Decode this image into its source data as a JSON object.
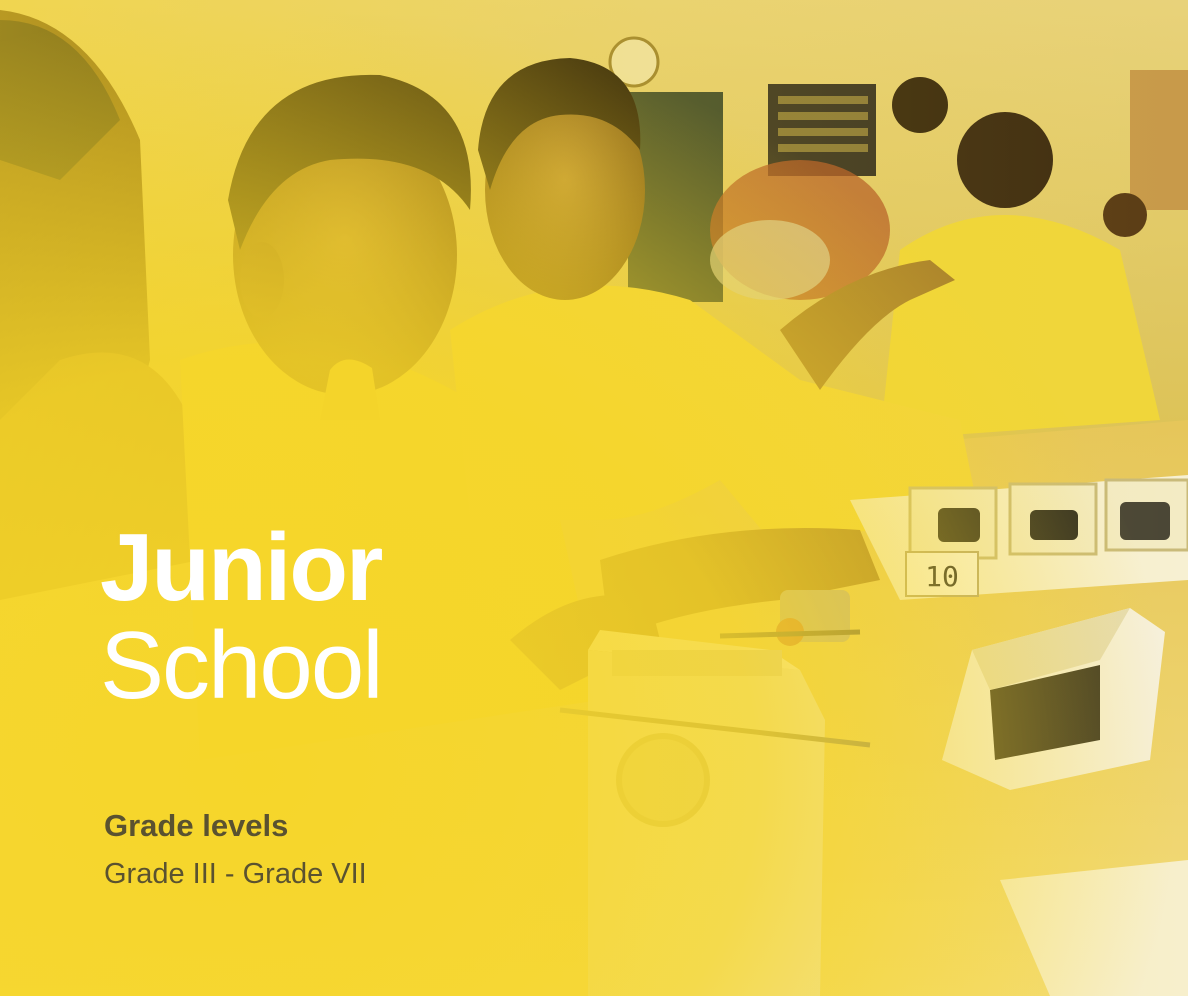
{
  "title": {
    "line1": "Junior",
    "line2": "School"
  },
  "grade": {
    "heading": "Grade levels",
    "range": "Grade III - Grade VII"
  },
  "photo": {
    "tray_label": "10"
  },
  "colors": {
    "overlay": "#f6d628",
    "title_text": "#ffffff",
    "grade_text": "#5a5230"
  }
}
